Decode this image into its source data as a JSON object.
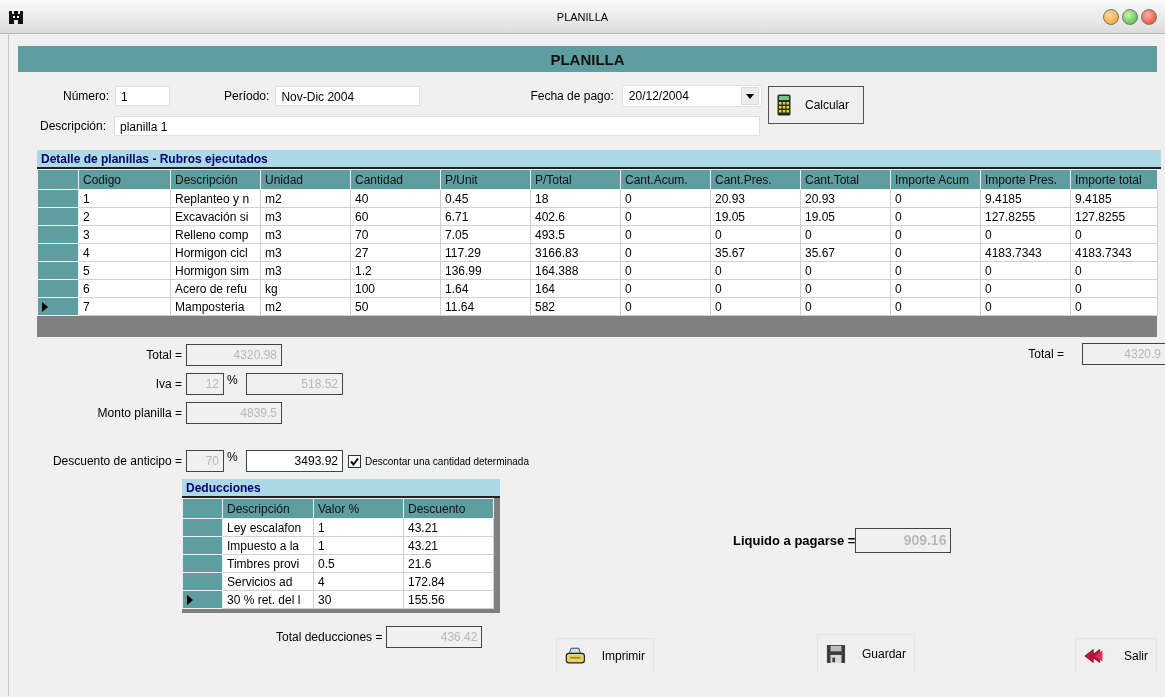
{
  "window": {
    "title": "PLANILLA"
  },
  "header": "PLANILLA",
  "form": {
    "numero": {
      "label": "Número:",
      "value": "1"
    },
    "periodo": {
      "label": "Período:",
      "value": "Nov-Dic 2004"
    },
    "fecha_pago": {
      "label": "Fecha de pago:",
      "value": "20/12/2004"
    },
    "descripcion": {
      "label": "Descripción:",
      "value": "planilla 1"
    },
    "calcular_button": "Calcular"
  },
  "detail": {
    "title": "Detalle de planillas - Rubros ejecutados",
    "columns": [
      "Codigo",
      "Descripción",
      "Unidad",
      "Cantidad",
      "P/Unit",
      "P/Total",
      "Cant.Acum.",
      "Cant.Pres.",
      "Cant.Total",
      "Importe Acum",
      "Importe Pres.",
      "Importe total"
    ],
    "rows": [
      {
        "selected": false,
        "cells": [
          "1",
          "Replanteo y n",
          "m2",
          "40",
          "0.45",
          "18",
          "0",
          "20.93",
          "20.93",
          "0",
          "9.4185",
          "9.4185"
        ]
      },
      {
        "selected": false,
        "cells": [
          "2",
          "Excavación si",
          "m3",
          "60",
          "6.71",
          "402.6",
          "0",
          "19.05",
          "19.05",
          "0",
          "127.8255",
          "127.8255"
        ]
      },
      {
        "selected": false,
        "cells": [
          "3",
          "Relleno comp",
          "m3",
          "70",
          "7.05",
          "493.5",
          "0",
          "0",
          "0",
          "0",
          "0",
          "0"
        ]
      },
      {
        "selected": false,
        "cells": [
          "4",
          "Hormigon cicl",
          "m3",
          "27",
          "117.29",
          "3166.83",
          "0",
          "35.67",
          "35.67",
          "0",
          "4183.7343",
          "4183.7343"
        ]
      },
      {
        "selected": false,
        "cells": [
          "5",
          "Hormigon sim",
          "m3",
          "1.2",
          "136.99",
          "164.388",
          "0",
          "0",
          "0",
          "0",
          "0",
          "0"
        ]
      },
      {
        "selected": false,
        "cells": [
          "6",
          "Acero de refu",
          "kg",
          "100",
          "1.64",
          "164",
          "0",
          "0",
          "0",
          "0",
          "0",
          "0"
        ]
      },
      {
        "selected": true,
        "cells": [
          "7",
          "Mamposteria",
          "m2",
          "50",
          "11.64",
          "582",
          "0",
          "0",
          "0",
          "0",
          "0",
          "0"
        ]
      }
    ]
  },
  "totals": {
    "total": {
      "label": "Total =",
      "value": "4320.98",
      "disabled": true
    },
    "iva": {
      "label": "Iva =",
      "percent": "12",
      "percent_sign": "%",
      "value": "518.52",
      "disabled": true
    },
    "monto": {
      "label": "Monto planilla =",
      "value": "4839.5",
      "disabled": true
    },
    "descuento": {
      "label": "Descuento de anticipo =",
      "percent": "70",
      "percent_sign": "%",
      "value": "3493.92",
      "disabled": false,
      "checkbox": {
        "label": "Descontar una cantidad determinada",
        "checked": true
      }
    }
  },
  "deducciones": {
    "title": "Deducciones",
    "columns": [
      "Descripción",
      "Valor %",
      "Descuento"
    ],
    "rows": [
      {
        "selected": false,
        "cells": [
          "Ley escalafon",
          "1",
          "43.21"
        ]
      },
      {
        "selected": false,
        "cells": [
          "Impuesto a la",
          "1",
          "43.21"
        ]
      },
      {
        "selected": false,
        "cells": [
          "Timbres provi",
          "0.5",
          "21.6"
        ]
      },
      {
        "selected": false,
        "cells": [
          "Servicios ad",
          "4",
          "172.84"
        ]
      },
      {
        "selected": true,
        "cells": [
          "30 % ret. del l",
          "30",
          "155.56"
        ]
      }
    ]
  },
  "total_deducciones": {
    "label": "Total deducciones =",
    "value": "436.42",
    "disabled": true
  },
  "right_total": {
    "label": "Total =",
    "value": "4320.9",
    "disabled": true
  },
  "liquido": {
    "label": "Liquido a pagarse =",
    "value": "909.16",
    "disabled": true
  },
  "buttons": [
    {
      "kind": "print",
      "label": "Imprimir"
    },
    {
      "kind": "save",
      "label": "Guardar"
    },
    {
      "kind": "exit",
      "label": "Salir"
    }
  ]
}
